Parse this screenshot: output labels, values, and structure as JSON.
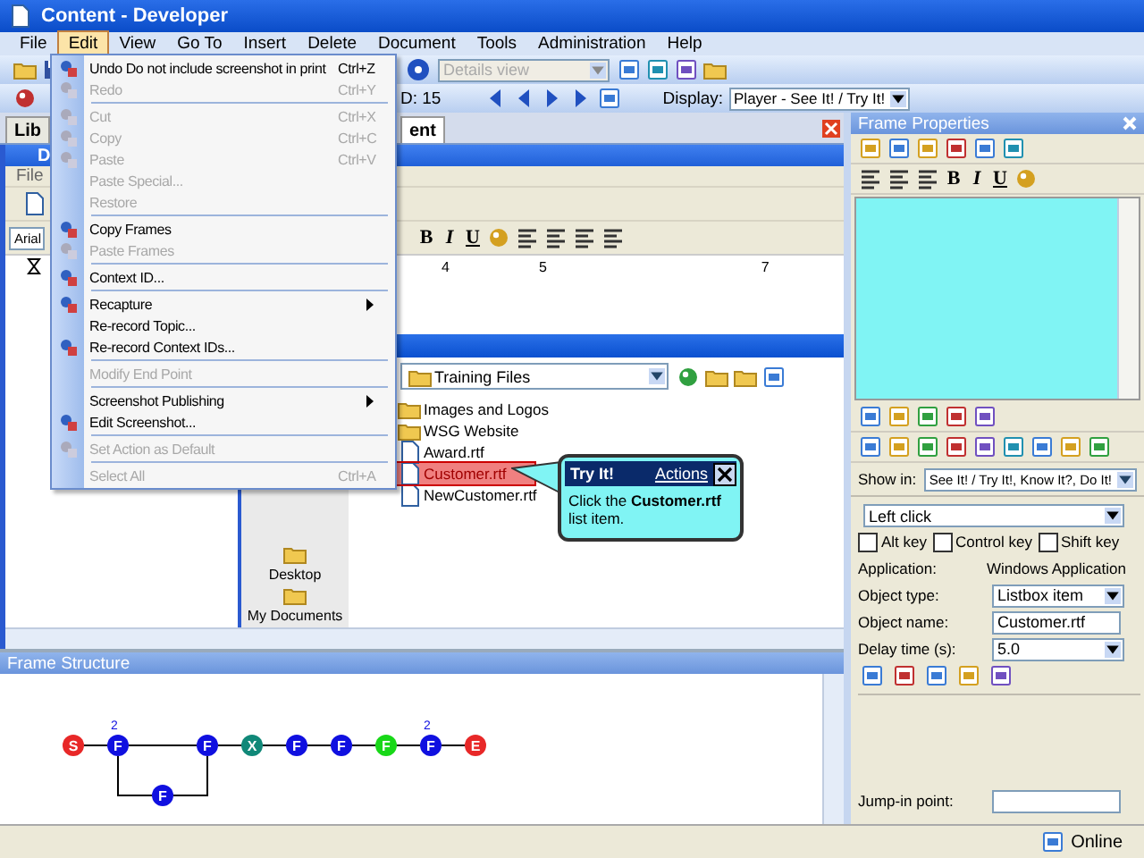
{
  "window": {
    "title": "Content - Developer"
  },
  "menu_bar": [
    {
      "label": "File",
      "selected": false
    },
    {
      "label": "Edit",
      "selected": true
    },
    {
      "label": "View",
      "selected": false
    },
    {
      "label": "Go To",
      "selected": false
    },
    {
      "label": "Insert",
      "selected": false
    },
    {
      "label": "Delete",
      "selected": false
    },
    {
      "label": "Document",
      "selected": false
    },
    {
      "label": "Tools",
      "selected": false
    },
    {
      "label": "Administration",
      "selected": false
    },
    {
      "label": "Help",
      "selected": false
    }
  ],
  "view_toolbar": {
    "view_combo": {
      "value": "Details view",
      "disabled": true
    }
  },
  "nav_toolbar": {
    "id_text": "D:  15",
    "display_label": "Display:",
    "display_value": "Player - See It! / Try It!"
  },
  "tabs": [
    {
      "label": "Lib",
      "selected": false
    },
    {
      "label": "ent",
      "selected": true
    }
  ],
  "document_window": {
    "title": "D",
    "menu": "File",
    "font": "Arial",
    "format_buttons": [
      "B",
      "I",
      "U"
    ],
    "ruler_labels": [
      "4",
      "5",
      "7"
    ]
  },
  "captured_screen": {
    "folder": "Training Files",
    "files": [
      {
        "name": "Images and Logos",
        "kind": "folder",
        "selected": false
      },
      {
        "name": "WSG Website",
        "kind": "folder",
        "selected": false
      },
      {
        "name": "Award.rtf",
        "kind": "file",
        "selected": false
      },
      {
        "name": "Customer.rtf",
        "kind": "file",
        "selected": true
      },
      {
        "name": "NewCustomer.rtf",
        "kind": "file",
        "selected": false
      }
    ],
    "places": [
      "Desktop",
      "My Documents"
    ]
  },
  "callout": {
    "title": "Try It!",
    "link": "Actions",
    "text": "Click the **Customer.rtf** list item."
  },
  "edit_menu": [
    {
      "kind": "item",
      "label": "Undo Do not include screenshot in print",
      "shortcut": "Ctrl+Z",
      "disabled": false,
      "submenu": false,
      "has_icon": true
    },
    {
      "kind": "item",
      "label": "Redo",
      "shortcut": "Ctrl+Y",
      "disabled": true,
      "submenu": false,
      "has_icon": true
    },
    {
      "kind": "separator"
    },
    {
      "kind": "item",
      "label": "Cut",
      "shortcut": "Ctrl+X",
      "disabled": true,
      "submenu": false,
      "has_icon": true
    },
    {
      "kind": "item",
      "label": "Copy",
      "shortcut": "Ctrl+C",
      "disabled": true,
      "submenu": false,
      "has_icon": true
    },
    {
      "kind": "item",
      "label": "Paste",
      "shortcut": "Ctrl+V",
      "disabled": true,
      "submenu": false,
      "has_icon": true
    },
    {
      "kind": "item",
      "label": "Paste Special...",
      "disabled": true,
      "submenu": false,
      "has_icon": false
    },
    {
      "kind": "item",
      "label": "Restore",
      "disabled": true,
      "submenu": false,
      "has_icon": false
    },
    {
      "kind": "separator"
    },
    {
      "kind": "item",
      "label": "Copy Frames",
      "disabled": false,
      "submenu": false,
      "has_icon": true
    },
    {
      "kind": "item",
      "label": "Paste Frames",
      "disabled": true,
      "submenu": false,
      "has_icon": true
    },
    {
      "kind": "separator"
    },
    {
      "kind": "item",
      "label": "Context ID...",
      "disabled": false,
      "submenu": false,
      "has_icon": true
    },
    {
      "kind": "separator"
    },
    {
      "kind": "item",
      "label": "Recapture",
      "disabled": false,
      "submenu": true,
      "has_icon": true
    },
    {
      "kind": "item",
      "label": "Re-record Topic...",
      "disabled": false,
      "submenu": false,
      "has_icon": false
    },
    {
      "kind": "item",
      "label": "Re-record Context IDs...",
      "disabled": false,
      "submenu": false,
      "has_icon": true
    },
    {
      "kind": "separator"
    },
    {
      "kind": "item",
      "label": "Modify End Point",
      "disabled": true,
      "submenu": false,
      "has_icon": false
    },
    {
      "kind": "separator"
    },
    {
      "kind": "item",
      "label": "Screenshot Publishing",
      "disabled": false,
      "submenu": true,
      "has_icon": false
    },
    {
      "kind": "item",
      "label": "Edit Screenshot...",
      "disabled": false,
      "submenu": false,
      "has_icon": true
    },
    {
      "kind": "separator"
    },
    {
      "kind": "item",
      "label": "Set Action as Default",
      "disabled": true,
      "submenu": false,
      "has_icon": true
    },
    {
      "kind": "separator"
    },
    {
      "kind": "item",
      "label": "Select All",
      "shortcut": "Ctrl+A",
      "disabled": true,
      "submenu": false,
      "has_icon": false
    }
  ],
  "frame_structure": {
    "title": "Frame Structure",
    "nodes": [
      {
        "label": "S",
        "color": "#e82828",
        "branch": false
      },
      {
        "label": "F",
        "color": "#1010e0",
        "branch": false,
        "badge": "2"
      },
      {
        "label": "F",
        "color": "#1010e0",
        "branch": true
      },
      {
        "label": "F",
        "color": "#1010e0",
        "branch": false
      },
      {
        "label": "X",
        "color": "#108878",
        "branch": false
      },
      {
        "label": "F",
        "color": "#1010e0",
        "branch": false
      },
      {
        "label": "F",
        "color": "#1010e0",
        "branch": false
      },
      {
        "label": "F",
        "color": "#18d818",
        "branch": false
      },
      {
        "label": "F",
        "color": "#1010e0",
        "branch": false,
        "badge": "2"
      },
      {
        "label": "E",
        "color": "#e82828",
        "branch": false
      }
    ]
  },
  "frame_properties": {
    "title": "Frame Properties",
    "format_buttons": [
      "B",
      "I",
      "U"
    ],
    "show_in_label": "Show in:",
    "show_in_value": "See It! / Try It!, Know It?, Do It!",
    "action": "Left click",
    "keys": [
      {
        "label": "Alt key",
        "checked": false
      },
      {
        "label": "Control key",
        "checked": false
      },
      {
        "label": "Shift key",
        "checked": false
      }
    ],
    "application_label": "Application:",
    "application_value": "Windows Application",
    "object_type_label": "Object type:",
    "object_type_value": "Listbox item",
    "object_name_label": "Object name:",
    "object_name_value": "Customer.rtf",
    "delay_label": "Delay time (s):",
    "delay_value": "5.0",
    "jump_in_label": "Jump-in point:"
  },
  "status_bar": {
    "text": "Online"
  }
}
